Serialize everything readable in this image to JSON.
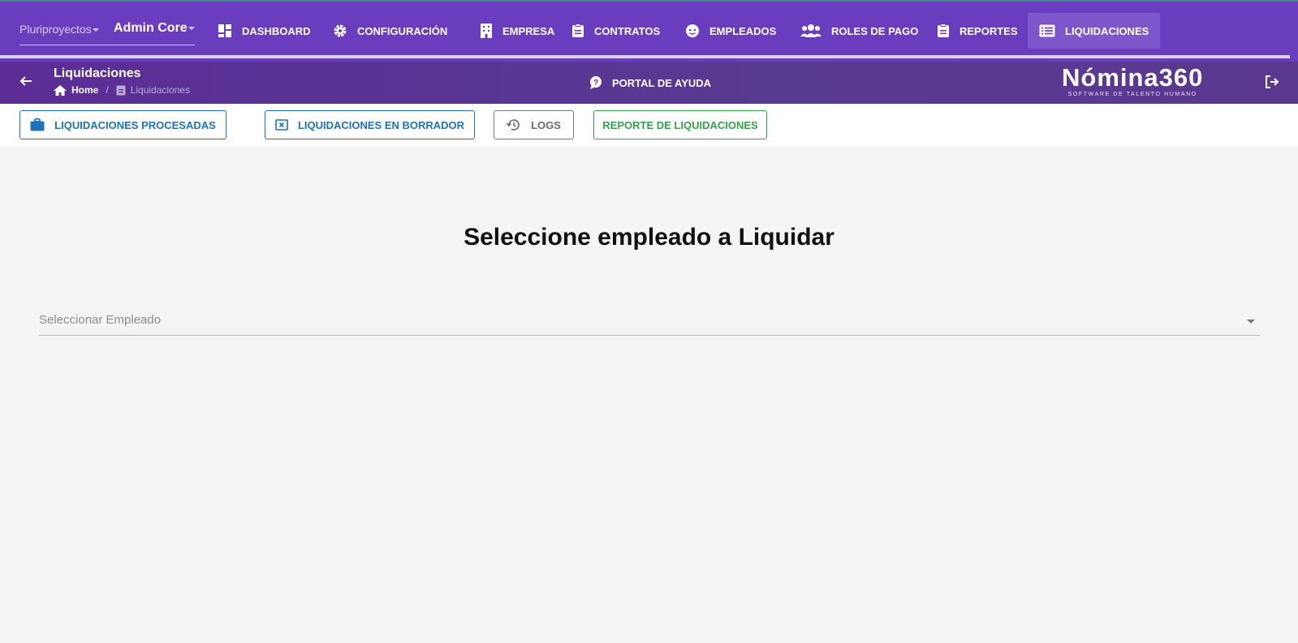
{
  "topbar": {
    "selectors": {
      "group": "Pluriproyectos",
      "company": "Admin Core"
    },
    "nav": [
      {
        "label": "DASHBOARD",
        "icon": "dashboard-icon"
      },
      {
        "label": "CONFIGURACIÓN",
        "icon": "gear-icon"
      },
      {
        "label": "EMPRESA",
        "icon": "building-icon"
      },
      {
        "label": "CONTRATOS",
        "icon": "clipboard-icon"
      },
      {
        "label": "EMPLEADOS",
        "icon": "face-icon"
      },
      {
        "label": "ROLES DE PAGO",
        "icon": "users-icon"
      },
      {
        "label": "REPORTES",
        "icon": "clipboard-icon"
      },
      {
        "label": "LIQUIDACIONES",
        "icon": "list-icon",
        "active": true
      }
    ]
  },
  "subheader": {
    "title": "Liquidaciones",
    "breadcrumb": {
      "home": "Home",
      "current": "Liquidaciones"
    },
    "help": "PORTAL DE AYUDA",
    "logo": {
      "brand": "Nómina360",
      "tagline": "SOFTWARE DE TALENTO HUMANO"
    }
  },
  "actions": {
    "processed": "LIQUIDACIONES PROCESADAS",
    "drafts": "LIQUIDACIONES EN BORRADOR",
    "logs": "LOGS",
    "report": "REPORTE DE LIQUIDACIONES"
  },
  "main": {
    "heading": "Seleccione empleado a Liquidar",
    "employee_select": {
      "placeholder": "Seleccionar Empleado"
    }
  },
  "colors": {
    "topbar": "#6a3dbf",
    "subheader": "#5b2d95",
    "primary_button": "#1f72b8",
    "success_button": "#33a34a",
    "background": "#f4f4f4"
  }
}
